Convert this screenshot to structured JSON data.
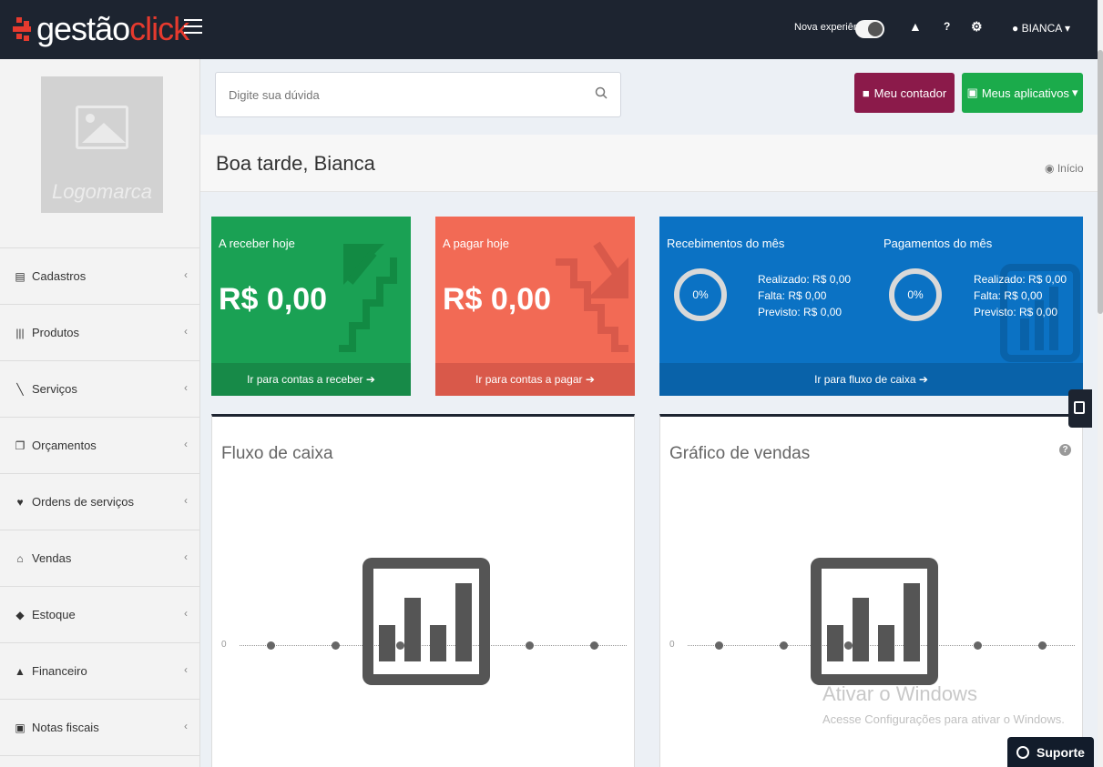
{
  "topbar": {
    "logo_part1": "gestão",
    "logo_part2": "click",
    "nova_experiencia": "Nova experiência",
    "user_name": "BIANCA",
    "icons": [
      "menu-icon",
      "alert-icon",
      "help-icon",
      "settings-icon",
      "user-icon",
      "caret-down-icon"
    ]
  },
  "sidebar": {
    "logo_text": "Logomarca",
    "items": [
      {
        "label": "Cadastros",
        "icon": "list-icon"
      },
      {
        "label": "Produtos",
        "icon": "barcode-icon"
      },
      {
        "label": "Serviços",
        "icon": "wrench-icon"
      },
      {
        "label": "Orçamentos",
        "icon": "copy-icon"
      },
      {
        "label": "Ordens de serviços",
        "icon": "cup-icon"
      },
      {
        "label": "Vendas",
        "icon": "basket-icon"
      },
      {
        "label": "Estoque",
        "icon": "cubes-icon"
      },
      {
        "label": "Financeiro",
        "icon": "bank-icon"
      },
      {
        "label": "Notas fiscais",
        "icon": "sitemap-icon"
      }
    ]
  },
  "search": {
    "placeholder": "Digite sua dúvida"
  },
  "buttons": {
    "contador": "Meu contador",
    "aplicativos": "Meus aplicativos"
  },
  "header": {
    "greeting": "Boa tarde, Bianca",
    "breadcrumb": "Início"
  },
  "cards": {
    "receber": {
      "title": "A receber hoje",
      "amount": "R$ 0,00",
      "link": "Ir para contas a receber"
    },
    "pagar": {
      "title": "A pagar hoje",
      "amount": "R$ 0,00",
      "link": "Ir para contas a pagar"
    },
    "fluxo": {
      "recebimentos_title": "Recebimentos do mês",
      "pagamentos_title": "Pagamentos do mês",
      "rec_percent": "0%",
      "pag_percent": "0%",
      "rec_realizado": "Realizado: R$ 0,00",
      "rec_falta": "Falta: R$ 0,00",
      "rec_previsto": "Previsto: R$ 0,00",
      "pag_realizado": "Realizado: R$ 0,00",
      "pag_falta": "Falta: R$ 0,00",
      "pag_previsto": "Previsto: R$ 0,00",
      "link": "Ir para fluxo de caixa"
    }
  },
  "panels": {
    "fluxo": {
      "title": "Fluxo de caixa",
      "axis_zero": "0"
    },
    "vendas": {
      "title": "Gráfico de vendas",
      "axis_zero": "0"
    }
  },
  "windows_watermark": {
    "line1": "Ativar o Windows",
    "line2": "Acesse Configurações para ativar o Windows."
  },
  "suporte": "Suporte",
  "colors": {
    "topbar": "#1d2430",
    "green": "#1aa154",
    "red": "#f26a55",
    "blue": "#0b72c4",
    "contador": "#8b1a4a",
    "apps": "#1bab4b",
    "brand_red": "#e63a2e"
  }
}
